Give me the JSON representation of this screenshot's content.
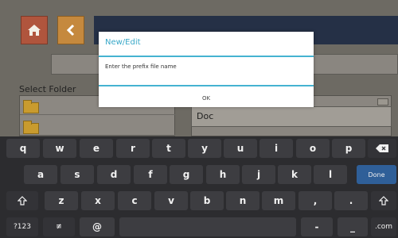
{
  "app": {
    "select_folder_label": "Select Folder",
    "file_value": "Doc",
    "home_icon": "home-icon",
    "back_icon": "chevron-left-icon"
  },
  "dialog": {
    "title": "New/Edit",
    "input_placeholder": "Enter the prefix file name",
    "ok_label": "OK"
  },
  "keyboard": {
    "row1": [
      "q",
      "w",
      "e",
      "r",
      "t",
      "y",
      "u",
      "i",
      "o",
      "p"
    ],
    "row2": [
      "a",
      "s",
      "d",
      "f",
      "g",
      "h",
      "j",
      "k",
      "l"
    ],
    "row3": [
      "z",
      "x",
      "c",
      "v",
      "b",
      "n",
      "m",
      ",",
      "."
    ],
    "done_label": "Done",
    "symbols_label": "?123",
    "emoji_label": "≢",
    "at_label": "@",
    "dash_label": "-",
    "underscore_label": "_",
    "dotcom_label": ".com",
    "backspace_icon": "backspace-icon",
    "shift_icon": "shift-icon"
  },
  "colors": {
    "accent": "#45b3d1",
    "done_key": "#2f5f98",
    "page_bg": "#fcf6cc"
  }
}
